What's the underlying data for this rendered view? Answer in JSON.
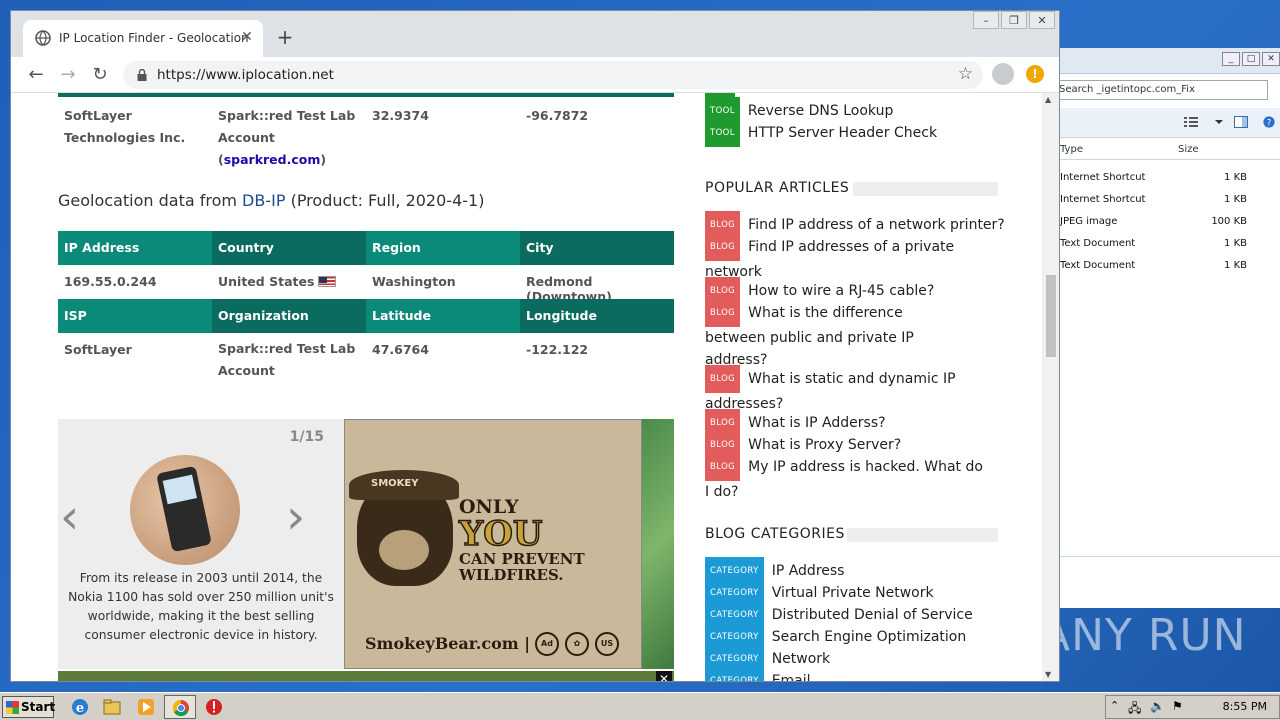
{
  "explorer": {
    "search_text": "Search _igetintopc.com_Fix",
    "columns": [
      "Type",
      "Size"
    ],
    "files": [
      {
        "type": "Internet Shortcut",
        "size": "1 KB"
      },
      {
        "type": "Internet Shortcut",
        "size": "1 KB"
      },
      {
        "type": "JPEG image",
        "size": "100 KB"
      },
      {
        "type": "Text Document",
        "size": "1 KB"
      },
      {
        "type": "Text Document",
        "size": "1 KB"
      }
    ]
  },
  "watermark": "ANY RUN",
  "browser": {
    "tab_title": "IP Location Finder - Geolocation",
    "url": "https://www.iplocation.net"
  },
  "top_row": {
    "isp": "SoftLayer Technologies Inc.",
    "org_prefix": "Spark::red Test Lab Account (",
    "org_link": "sparkred.com",
    "org_suffix": ")",
    "latitude": "32.9374",
    "longitude": "-96.7872"
  },
  "section": {
    "prefix": "Geolocation data from ",
    "source": "DB-IP",
    "suffix": " (Product: Full, 2020-4-1)"
  },
  "geo_table": {
    "headers1": [
      "IP Address",
      "Country",
      "Region",
      "City"
    ],
    "row1": [
      "169.55.0.244",
      "United States",
      "Washington",
      "Redmond (Downtown)"
    ],
    "headers2": [
      "ISP",
      "Organization",
      "Latitude",
      "Longitude"
    ],
    "row2": [
      "SoftLayer",
      "Spark::red Test Lab Account",
      "47.6764",
      "-122.122"
    ]
  },
  "slider": {
    "counter": "1/15",
    "caption": "From its release in 2003 until 2014, the Nokia 1100 has sold over 250 million unit's worldwide, making it the best selling consumer electronic device in history."
  },
  "ad": {
    "hatband": "SMOKEY",
    "line1": "ONLY",
    "line2": "YOU",
    "line3": "CAN PREVENT",
    "line4": "WILDFIRES.",
    "url": "SmokeyBear.com |"
  },
  "sidebar": {
    "tools": [
      {
        "tag": "TOOL",
        "label": "Reverse DNS Lookup"
      },
      {
        "tag": "TOOL",
        "label": "HTTP Server Header Check"
      }
    ],
    "popular_title": "POPULAR ARTICLES",
    "articles": [
      {
        "tag": "BLOG",
        "label": "Find IP address of a network printer?"
      },
      {
        "tag": "BLOG",
        "label": "Find IP addresses of a private network"
      },
      {
        "tag": "BLOG",
        "label": "How to wire a RJ-45 cable?"
      },
      {
        "tag": "BLOG",
        "label": "What is the difference between public and private IP address?"
      },
      {
        "tag": "BLOG",
        "label": "What is static and dynamic IP addresses?"
      },
      {
        "tag": "BLOG",
        "label": "What is IP Adderss?"
      },
      {
        "tag": "BLOG",
        "label": "What is Proxy Server?"
      },
      {
        "tag": "BLOG",
        "label": "My IP address is hacked. What do I do?"
      }
    ],
    "categories_title": "BLOG CATEGORIES",
    "categories": [
      {
        "tag": "CATEGORY",
        "label": "IP Address"
      },
      {
        "tag": "CATEGORY",
        "label": "Virtual Private Network"
      },
      {
        "tag": "CATEGORY",
        "label": "Distributed Denial of Service"
      },
      {
        "tag": "CATEGORY",
        "label": "Search Engine Optimization"
      },
      {
        "tag": "CATEGORY",
        "label": "Network"
      },
      {
        "tag": "CATEGORY",
        "label": "Email"
      }
    ]
  },
  "taskbar": {
    "start_label": "Start",
    "time": "8:55 PM"
  }
}
